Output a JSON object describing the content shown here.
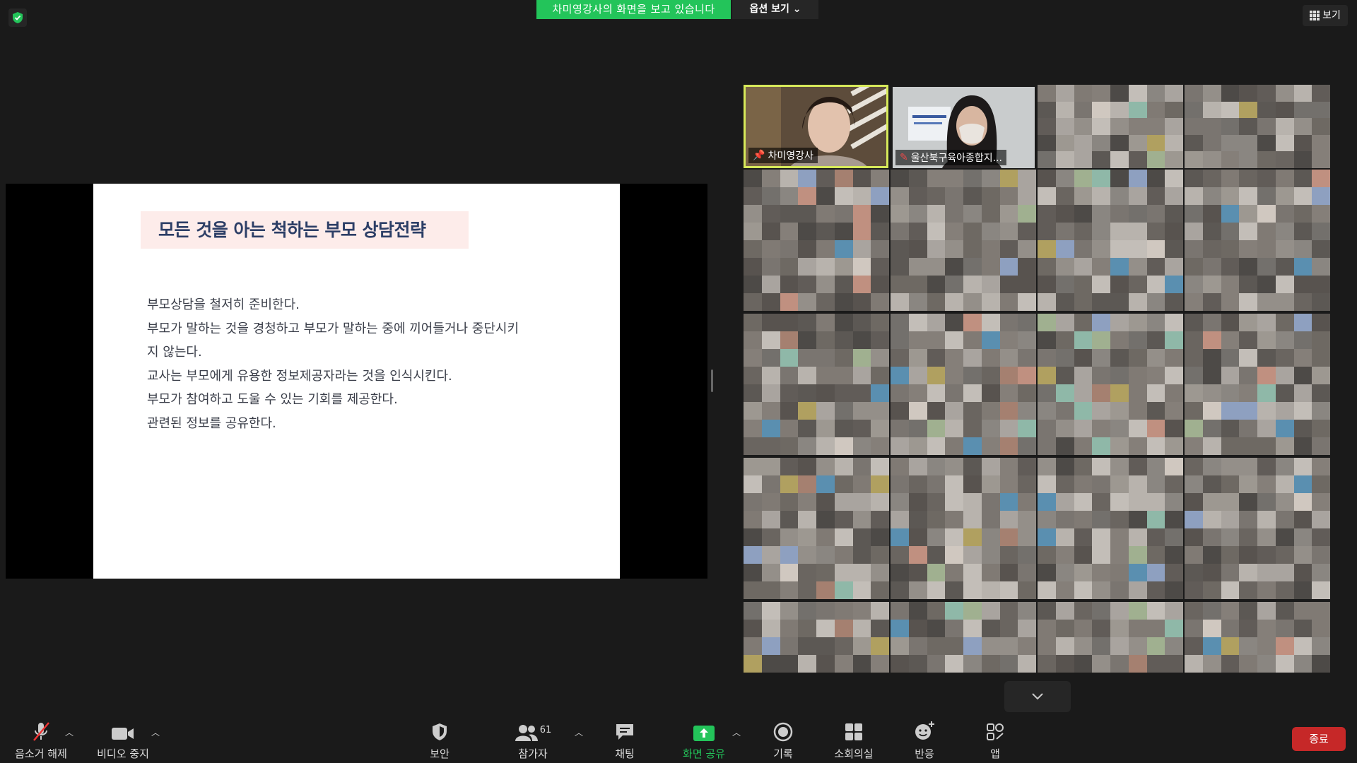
{
  "top": {
    "share_banner": "차미영강사의 화면을 보고 있습니다",
    "view_options": "옵션 보기",
    "view_button": "보기"
  },
  "slide": {
    "title": "모든 것을 아는 척하는 부모 상담전략",
    "lines": [
      "부모상담을 철저히 준비한다.",
      "부모가 말하는 것을 경청하고 부모가 말하는 중에 끼어들거나 중단시키",
      "지 않는다.",
      "교사는 부모에게 유용한 정보제공자라는 것을 인식시킨다.",
      "부모가 참여하고 도울 수 있는 기회를 제공한다.",
      "관련된 정보를 공유한다."
    ]
  },
  "participants": {
    "named": [
      {
        "name": "차미영강사",
        "icon": "pin-icon",
        "active_speaker": true
      },
      {
        "name": "울산북구육아종합지...",
        "icon": "mic-muted-icon",
        "active_speaker": false
      }
    ]
  },
  "toolbar": {
    "unmute": "음소거 해제",
    "stop_video": "비디오 중지",
    "security": "보안",
    "participants": "참가자",
    "participants_count": "61",
    "chat": "채팅",
    "share_screen": "화면 공유",
    "record": "기록",
    "breakout": "소회의실",
    "reactions": "반응",
    "apps": "앱",
    "end": "종료"
  },
  "colors": {
    "accent_green": "#23c45a",
    "end_red": "#c62828",
    "speaker_highlight": "#d7e95a",
    "slide_title": "#2c3e66"
  }
}
